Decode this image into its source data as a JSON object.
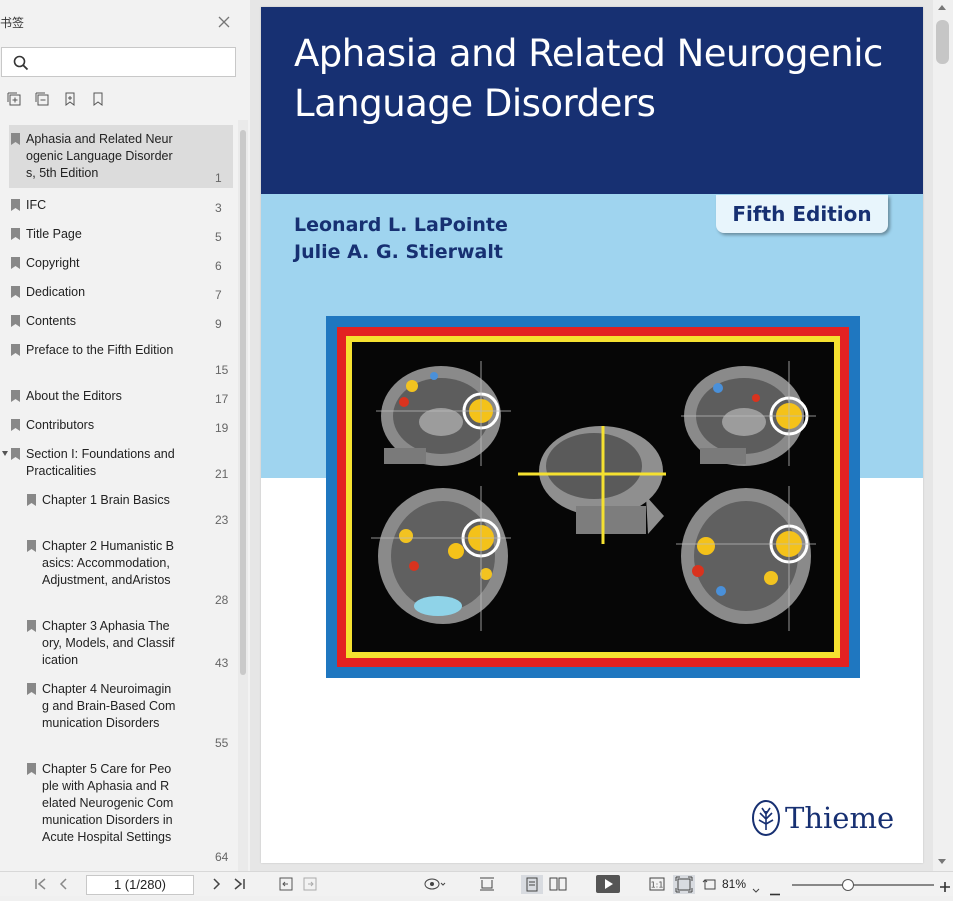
{
  "sidebar": {
    "title": "书签",
    "search_placeholder": "",
    "bookmarks": [
      {
        "label": "Aphasia and Related Neurogenic Language Disorders, 5th Edition",
        "page": "1"
      },
      {
        "label": "IFC",
        "page": "3"
      },
      {
        "label": "Title Page",
        "page": "5"
      },
      {
        "label": "Copyright",
        "page": "6"
      },
      {
        "label": "Dedication",
        "page": "7"
      },
      {
        "label": "Contents",
        "page": "9"
      },
      {
        "label": "Preface to the Fifth Edition",
        "page": "15"
      },
      {
        "label": "About the Editors",
        "page": "17"
      },
      {
        "label": "Contributors",
        "page": "19"
      },
      {
        "label": "Section I: Foundations and Practicalities",
        "page": "21"
      },
      {
        "label": "Chapter 1 Brain Basics",
        "page": "23"
      },
      {
        "label": "Chapter 2 Humanistic Basics: Accommodation, Adjustment, andAristos",
        "page": "28"
      },
      {
        "label": "Chapter 3 Aphasia Theory, Models, and Classification",
        "page": "43"
      },
      {
        "label": "Chapter 4 Neuroimaging and Brain-Based Communication Disorders",
        "page": "55"
      },
      {
        "label": "Chapter 5 Care for People with Aphasia and Related Neurogenic Communication Disorders in Acute Hospital Settings",
        "page": "64"
      }
    ]
  },
  "cover": {
    "title_line1": "Aphasia and Related Neurogenic",
    "title_line2": "Language Disorders",
    "edition": "Fifth Edition",
    "author1": "Leonard L. LaPointe",
    "author2": "Julie A. G. Stierwalt",
    "publisher": "Thieme"
  },
  "toolbar": {
    "page_indicator": "1 (1/280)",
    "zoom": "81%"
  },
  "colors": {
    "cover_navy": "#173072",
    "cover_lightblue": "#9fd4ef",
    "frame_red": "#e32222",
    "frame_yellow": "#f5e130",
    "frame_blue": "#1f77c0"
  }
}
